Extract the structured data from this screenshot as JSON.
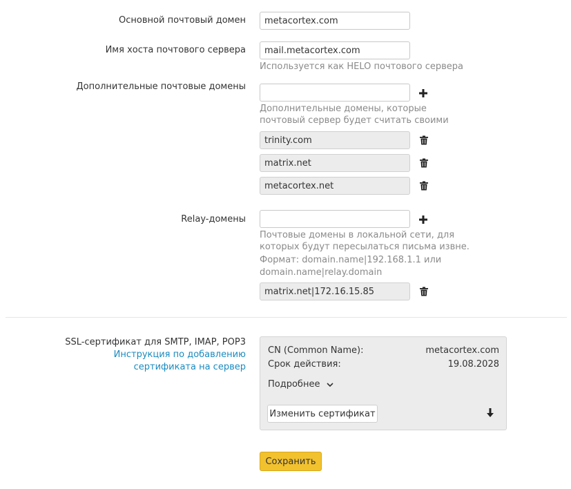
{
  "form": {
    "primary_domain": {
      "label": "Основной почтовый домен",
      "value": "metacortex.com"
    },
    "hostname": {
      "label": "Имя хоста почтового сервера",
      "value": "mail.metacortex.com",
      "hint": "Используется как HELO почтового сервера"
    },
    "extra_domains": {
      "label": "Дополнительные почтовые домены",
      "value": "",
      "hint_line1": "Дополнительные домены, которые",
      "hint_line2": "почтовый сервер будет считать своими",
      "items": [
        "trinity.com",
        "matrix.net",
        "metacortex.net"
      ]
    },
    "relay_domains": {
      "label": "Relay-домены",
      "value": "",
      "hint_line1": "Почтовые домены в локальной сети, для",
      "hint_line2": "которых будут пересылаться письма извне.",
      "hint_line3": "Формат: domain.name|192.168.1.1 или",
      "hint_line4": "domain.name|relay.domain",
      "items": [
        "matrix.net|172.16.15.85"
      ]
    }
  },
  "ssl": {
    "label": "SSL-сертификат для SMTP, IMAP, POP3",
    "link_line1": "Инструкция по добавлению",
    "link_line2": "сертификата на сервер",
    "cn_label": "CN (Common Name):",
    "cn_value": "metacortex.com",
    "expiry_label": "Срок действия:",
    "expiry_value": "19.08.2028",
    "details_label": "Подробнее",
    "change_button": "Изменить сертификат"
  },
  "save_button": "Сохранить",
  "icons": {
    "add": "plus-icon",
    "delete": "trash-icon",
    "expand": "chevron-down-icon",
    "download": "download-arrow-icon"
  }
}
